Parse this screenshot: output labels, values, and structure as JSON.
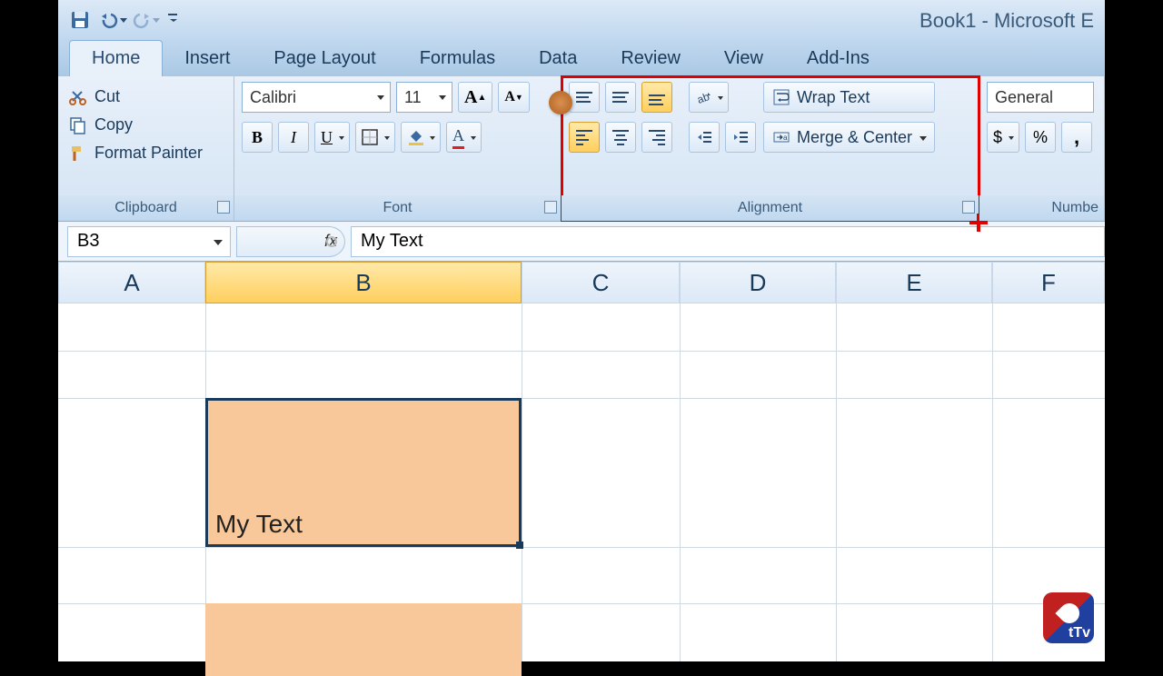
{
  "window": {
    "title": "Book1 - Microsoft E"
  },
  "tabs": {
    "home": "Home",
    "insert": "Insert",
    "page_layout": "Page Layout",
    "formulas": "Formulas",
    "data": "Data",
    "review": "Review",
    "view": "View",
    "addins": "Add-Ins"
  },
  "clipboard": {
    "label": "Clipboard",
    "cut": "Cut",
    "copy": "Copy",
    "paint": "Format Painter"
  },
  "font": {
    "label": "Font",
    "name": "Calibri",
    "size": "11",
    "bold": "B",
    "italic": "I",
    "underline": "U"
  },
  "alignment": {
    "label": "Alignment",
    "wrap": "Wrap Text",
    "merge": "Merge & Center"
  },
  "number": {
    "label": "Numbe",
    "format": "General",
    "currency": "$",
    "percent": "%"
  },
  "formula_bar": {
    "cell_ref": "B3",
    "fx": "fx",
    "value": "My Text"
  },
  "columns": [
    "A",
    "B",
    "C",
    "D",
    "E",
    "F"
  ],
  "cells": {
    "b3": "My Text"
  },
  "logo": "tTv"
}
